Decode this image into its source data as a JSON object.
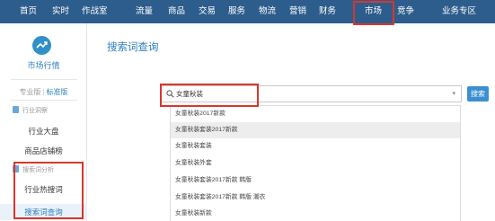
{
  "topnav": {
    "items": [
      "首页",
      "实时",
      "作战室",
      "流量",
      "商品",
      "交易",
      "服务",
      "物流",
      "营销",
      "财务",
      "市场",
      "竞争",
      "业务专区"
    ],
    "active": "市场"
  },
  "sidebar": {
    "title": "市场行情",
    "version_pro": "专业版",
    "version_std": "标准版",
    "section1": "行业洞察",
    "items1": [
      "行业大盘",
      "商品店铺榜"
    ],
    "section2": "搜索词分析",
    "items2": [
      "行业热搜词",
      "搜索词查询"
    ],
    "active_item": "搜索词查询"
  },
  "main": {
    "page_title": "搜索词查询",
    "search": {
      "value": "女童秋装",
      "button_label": "搜索"
    },
    "suggestions": [
      "女童秋装2017新款",
      "女童秋装套装2017新款",
      "女童秋装套装",
      "女童秋装外套",
      "女童秋装套装2017新款 韩版",
      "女童秋装套装2017新款 韩版 潮衣",
      "女童秋装新款"
    ],
    "highlighted_suggestion_index": 1
  },
  "colors": {
    "nav_bg": "#2d5d8c",
    "accent": "#2d7fbd",
    "highlight_border": "#d9362c",
    "search_button": "#3a8fd0"
  }
}
